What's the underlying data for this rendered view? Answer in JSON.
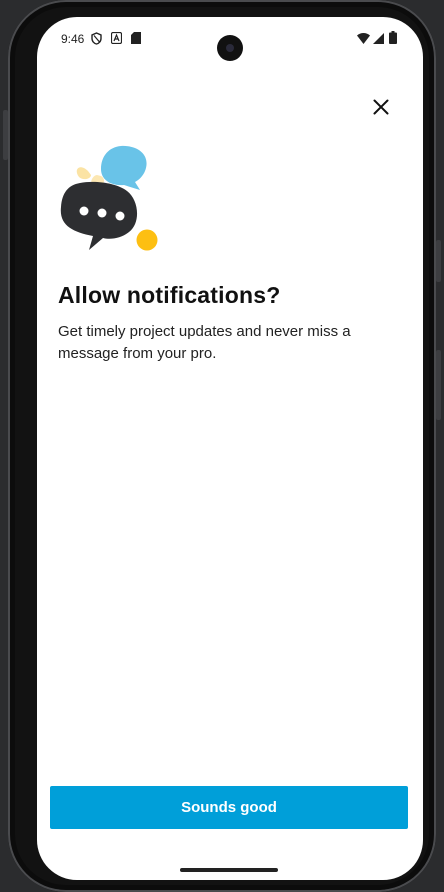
{
  "status_bar": {
    "time": "9:46",
    "left_icons": [
      "shield-icon",
      "a-badge-icon",
      "sd-card-icon"
    ],
    "right_icons": [
      "wifi-icon",
      "signal-icon",
      "battery-icon"
    ]
  },
  "dialog": {
    "close_icon": "close-icon",
    "illustration": "chat-bubbles-icon",
    "title": "Allow notifications?",
    "description": "Get timely project updates and never miss a message from your pro.",
    "primary_button_label": "Sounds good"
  },
  "colors": {
    "accent": "#009fd9",
    "bubble_dark": "#2d2e31",
    "bubble_blue": "#69c3e8",
    "bubble_cream": "#fbe3a4",
    "dot_yellow": "#fdbf12"
  }
}
